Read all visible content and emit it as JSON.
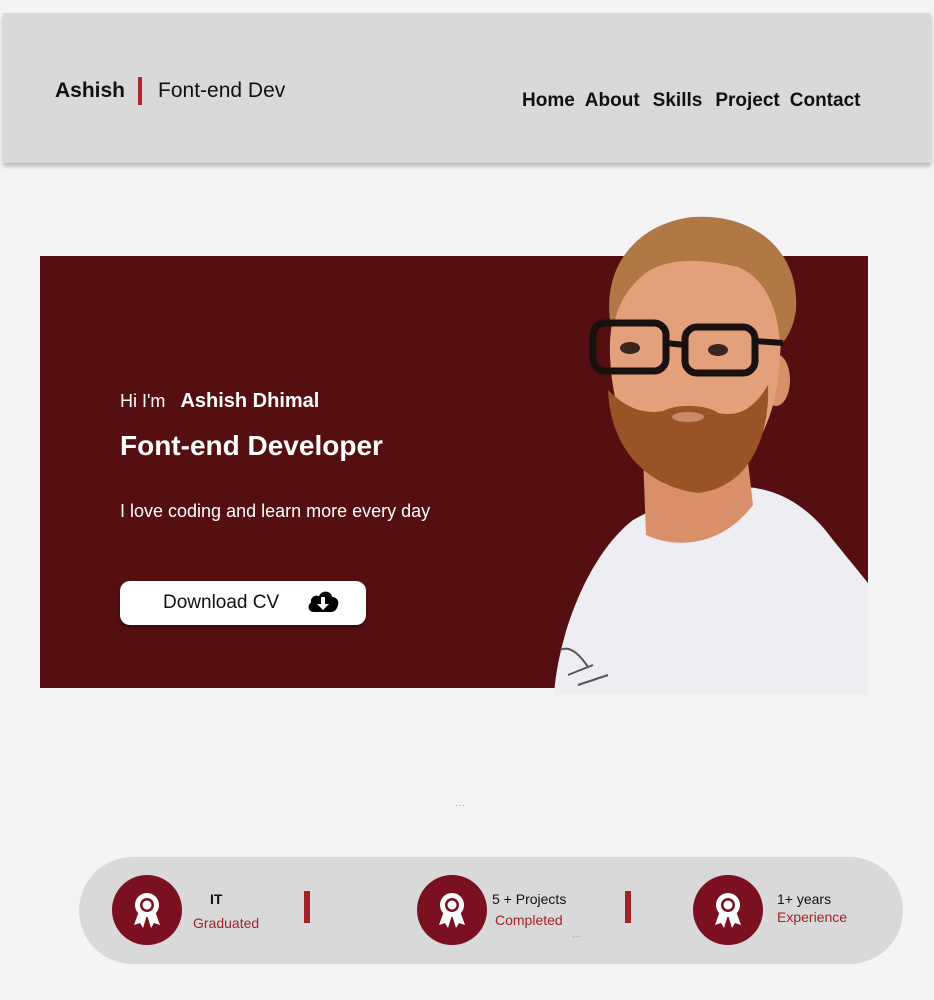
{
  "header": {
    "brand_name": "Ashish",
    "brand_role": "Font-end Dev",
    "nav": [
      "Home",
      "About",
      "Skills",
      "Project",
      "Contact"
    ]
  },
  "hero": {
    "greeting": "Hi I'm",
    "name": "Ashish Dhimal",
    "title": "Font-end Developer",
    "tagline": "I love coding and learn more every day",
    "cta_label": "Download CV",
    "cta_icon": "cloud-download-icon"
  },
  "stats": [
    {
      "top": "IT",
      "bottom": "Graduated",
      "icon": "award-icon"
    },
    {
      "top": "5 + Projects",
      "bottom": "Completed",
      "icon": "award-icon"
    },
    {
      "top": "1+ years",
      "bottom": "Experience",
      "icon": "award-icon"
    }
  ],
  "misc": {
    "dots": "···"
  },
  "colors": {
    "accent": "#b3262a",
    "hero_bg": "#560f11",
    "badge_bg": "#7a1020",
    "header_bg": "#d9d9d9",
    "page_bg": "#f4f4f4"
  }
}
